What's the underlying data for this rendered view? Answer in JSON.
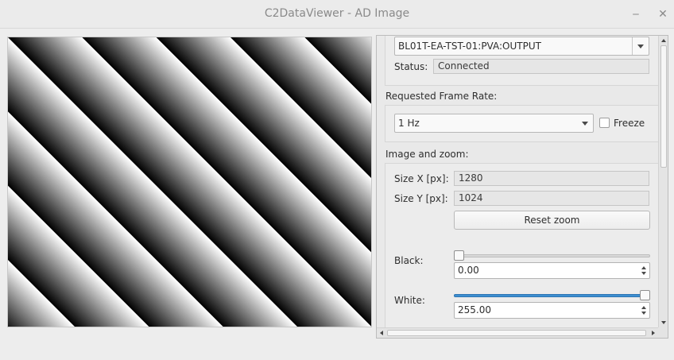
{
  "window": {
    "title": "C2DataViewer - AD Image",
    "minimize_glyph": "‒",
    "close_glyph": "✕"
  },
  "image": {
    "pattern": "diagonal-gradient-stripes",
    "colors": {
      "dark": "#000000",
      "light": "#ffffff"
    }
  },
  "pv": {
    "name": "BL01T-EA-TST-01:PVA:OUTPUT",
    "status_label": "Status:",
    "status_value": "Connected"
  },
  "frame_rate": {
    "section_label": "Requested Frame Rate:",
    "selected": "1 Hz",
    "freeze_label": "Freeze",
    "freeze_checked": false
  },
  "image_zoom": {
    "section_label": "Image and zoom:",
    "size_x_label": "Size X [px]:",
    "size_x_value": "1280",
    "size_y_label": "Size Y [px]:",
    "size_y_value": "1024",
    "reset_zoom_label": "Reset zoom"
  },
  "levels": {
    "black_label": "Black:",
    "black_value": "0.00",
    "black_level_fraction": 0.0,
    "white_label": "White:",
    "white_value": "255.00",
    "white_level_fraction": 1.0,
    "accent_color": "#3d8fd1"
  }
}
